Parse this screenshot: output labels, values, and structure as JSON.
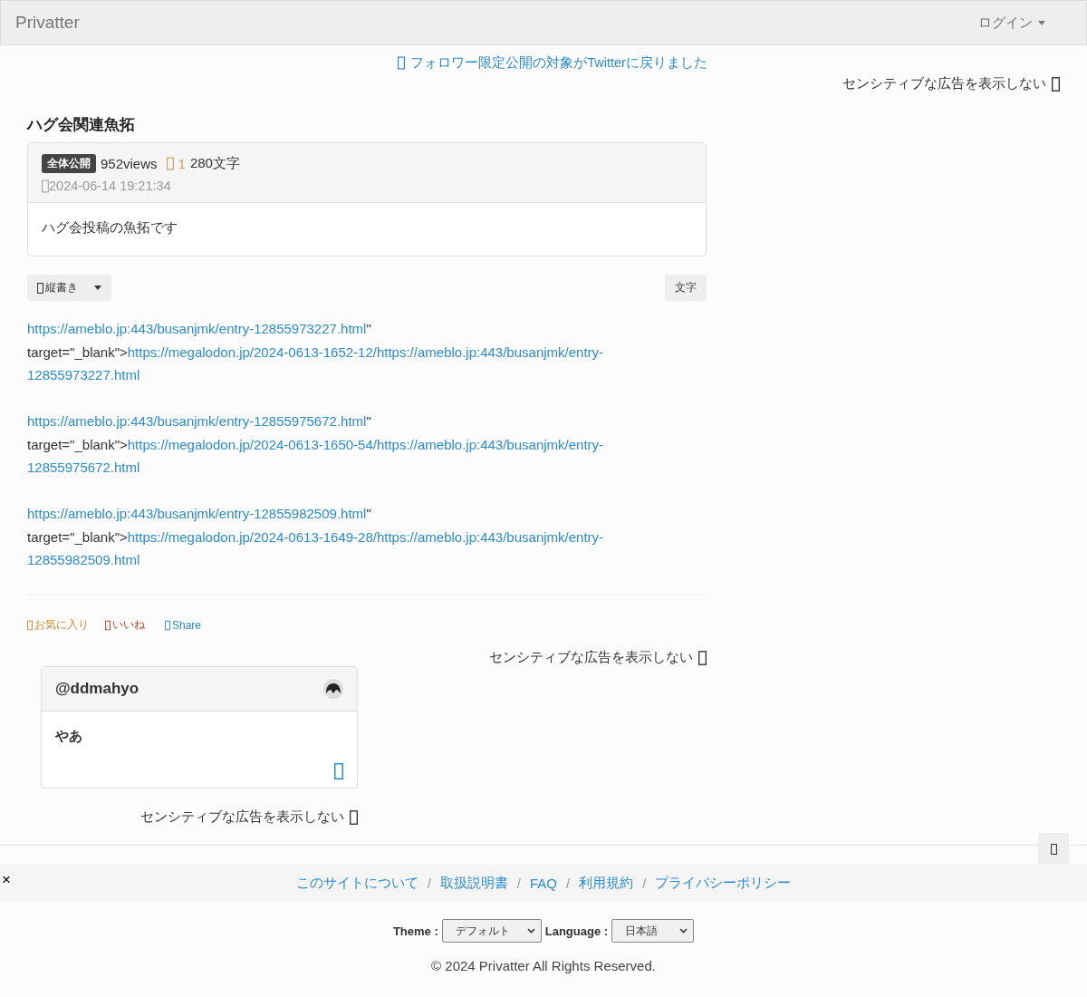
{
  "navbar": {
    "brand": "Privatter",
    "login": "ログイン"
  },
  "notice": "フォロワー限定公開の対象がTwitterに戻りました",
  "top_ad_toggle": "センシティブな広告を表示しない",
  "post": {
    "title": "ハグ会関連魚拓",
    "badge": "全体公開",
    "views": "952views",
    "count": "1",
    "chars": "280文字",
    "date": "2024-06-14 19:21:34",
    "summary": "ハグ会投稿の魚拓です"
  },
  "toolbar": {
    "vertical": "縦書き",
    "font": "文字"
  },
  "body_blocks": [
    {
      "link": "https://ameblo.jp:443/busanjmk/entry-12855973227.html",
      "quote": "\"",
      "attribute": "target=\"_blank\">",
      "archive_link_lines": [
        "https://megalodon.jp/2024-0613-1652-12/https://ameblo.jp:443/busanjmk/entry-",
        "12855973227.html"
      ]
    },
    {
      "link": "https://ameblo.jp:443/busanjmk/entry-12855975672.html",
      "quote": "\"",
      "attribute": "target=\"_blank\">",
      "archive_link_lines": [
        "https://megalodon.jp/2024-0613-1650-54/https://ameblo.jp:443/busanjmk/entry-",
        "12855975672.html"
      ]
    },
    {
      "link": "https://ameblo.jp:443/busanjmk/entry-12855982509.html",
      "quote": "\"",
      "attribute": "target=\"_blank\">",
      "archive_link_lines": [
        "https://megalodon.jp/2024-0613-1649-28/https://ameblo.jp:443/busanjmk/entry-",
        "12855982509.html"
      ]
    }
  ],
  "actions": [
    {
      "label": "お気に入り",
      "kind": "favorite"
    },
    {
      "label": "いいね",
      "kind": "like"
    },
    {
      "label": "Share",
      "kind": "share"
    }
  ],
  "post_ad_toggle": "センシティブな広告を表示しない",
  "comment": {
    "user": "@ddmahyo",
    "text": "やあ"
  },
  "comment_ad_toggle": "センシティブな広告を表示しない",
  "footer": {
    "close": "×",
    "links": [
      "このサイトについて",
      "取扱説明書",
      "FAQ",
      "利用規約",
      "プライバシーポリシー"
    ],
    "separator": "/",
    "theme_label": "Theme :",
    "theme_value": "デフォルト",
    "language_label": "Language :",
    "language_value": "日本語",
    "copyright": "© 2024 Privatter All Rights Reserved."
  }
}
